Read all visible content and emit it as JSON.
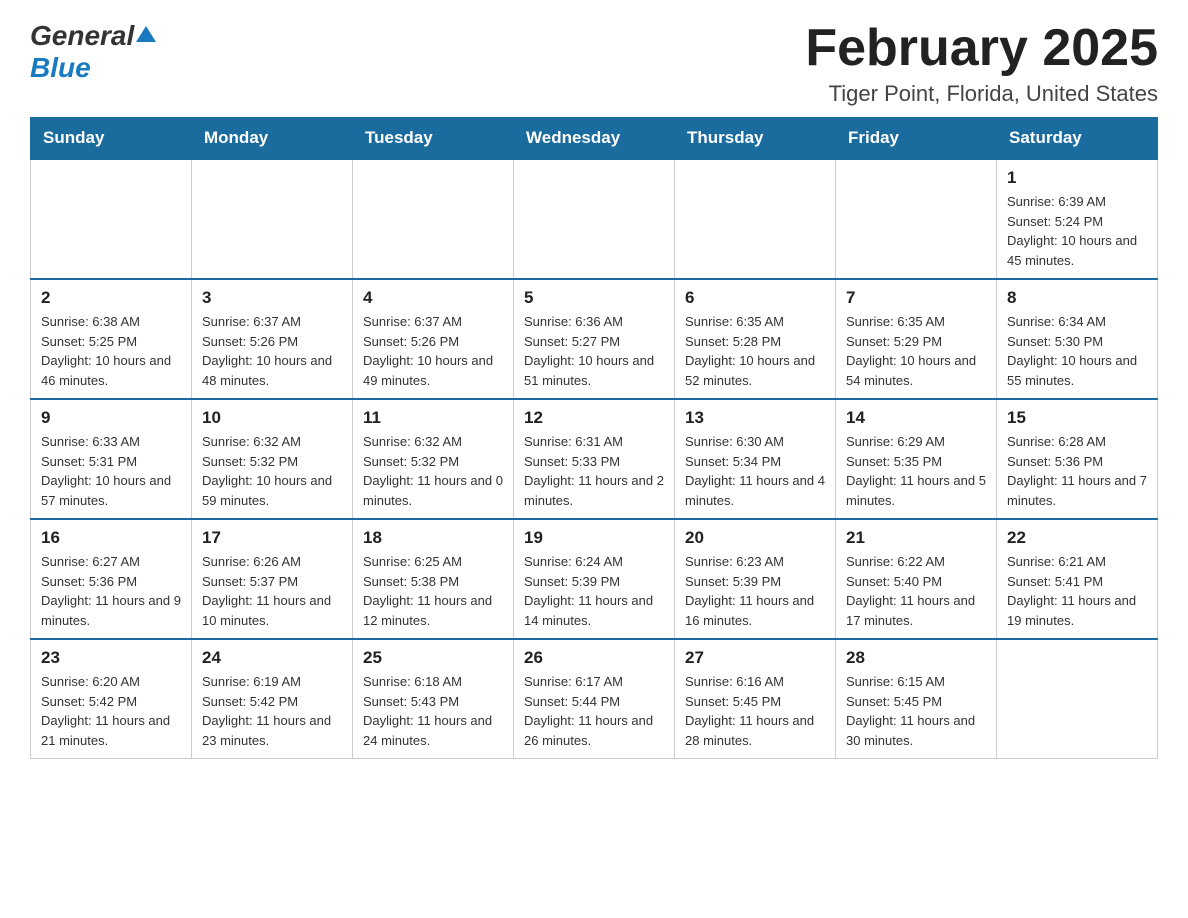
{
  "header": {
    "logo_general": "General",
    "logo_blue": "Blue",
    "month_title": "February 2025",
    "location": "Tiger Point, Florida, United States"
  },
  "days_of_week": [
    "Sunday",
    "Monday",
    "Tuesday",
    "Wednesday",
    "Thursday",
    "Friday",
    "Saturday"
  ],
  "weeks": [
    [
      {
        "day": "",
        "info": ""
      },
      {
        "day": "",
        "info": ""
      },
      {
        "day": "",
        "info": ""
      },
      {
        "day": "",
        "info": ""
      },
      {
        "day": "",
        "info": ""
      },
      {
        "day": "",
        "info": ""
      },
      {
        "day": "1",
        "info": "Sunrise: 6:39 AM\nSunset: 5:24 PM\nDaylight: 10 hours and 45 minutes."
      }
    ],
    [
      {
        "day": "2",
        "info": "Sunrise: 6:38 AM\nSunset: 5:25 PM\nDaylight: 10 hours and 46 minutes."
      },
      {
        "day": "3",
        "info": "Sunrise: 6:37 AM\nSunset: 5:26 PM\nDaylight: 10 hours and 48 minutes."
      },
      {
        "day": "4",
        "info": "Sunrise: 6:37 AM\nSunset: 5:26 PM\nDaylight: 10 hours and 49 minutes."
      },
      {
        "day": "5",
        "info": "Sunrise: 6:36 AM\nSunset: 5:27 PM\nDaylight: 10 hours and 51 minutes."
      },
      {
        "day": "6",
        "info": "Sunrise: 6:35 AM\nSunset: 5:28 PM\nDaylight: 10 hours and 52 minutes."
      },
      {
        "day": "7",
        "info": "Sunrise: 6:35 AM\nSunset: 5:29 PM\nDaylight: 10 hours and 54 minutes."
      },
      {
        "day": "8",
        "info": "Sunrise: 6:34 AM\nSunset: 5:30 PM\nDaylight: 10 hours and 55 minutes."
      }
    ],
    [
      {
        "day": "9",
        "info": "Sunrise: 6:33 AM\nSunset: 5:31 PM\nDaylight: 10 hours and 57 minutes."
      },
      {
        "day": "10",
        "info": "Sunrise: 6:32 AM\nSunset: 5:32 PM\nDaylight: 10 hours and 59 minutes."
      },
      {
        "day": "11",
        "info": "Sunrise: 6:32 AM\nSunset: 5:32 PM\nDaylight: 11 hours and 0 minutes."
      },
      {
        "day": "12",
        "info": "Sunrise: 6:31 AM\nSunset: 5:33 PM\nDaylight: 11 hours and 2 minutes."
      },
      {
        "day": "13",
        "info": "Sunrise: 6:30 AM\nSunset: 5:34 PM\nDaylight: 11 hours and 4 minutes."
      },
      {
        "day": "14",
        "info": "Sunrise: 6:29 AM\nSunset: 5:35 PM\nDaylight: 11 hours and 5 minutes."
      },
      {
        "day": "15",
        "info": "Sunrise: 6:28 AM\nSunset: 5:36 PM\nDaylight: 11 hours and 7 minutes."
      }
    ],
    [
      {
        "day": "16",
        "info": "Sunrise: 6:27 AM\nSunset: 5:36 PM\nDaylight: 11 hours and 9 minutes."
      },
      {
        "day": "17",
        "info": "Sunrise: 6:26 AM\nSunset: 5:37 PM\nDaylight: 11 hours and 10 minutes."
      },
      {
        "day": "18",
        "info": "Sunrise: 6:25 AM\nSunset: 5:38 PM\nDaylight: 11 hours and 12 minutes."
      },
      {
        "day": "19",
        "info": "Sunrise: 6:24 AM\nSunset: 5:39 PM\nDaylight: 11 hours and 14 minutes."
      },
      {
        "day": "20",
        "info": "Sunrise: 6:23 AM\nSunset: 5:39 PM\nDaylight: 11 hours and 16 minutes."
      },
      {
        "day": "21",
        "info": "Sunrise: 6:22 AM\nSunset: 5:40 PM\nDaylight: 11 hours and 17 minutes."
      },
      {
        "day": "22",
        "info": "Sunrise: 6:21 AM\nSunset: 5:41 PM\nDaylight: 11 hours and 19 minutes."
      }
    ],
    [
      {
        "day": "23",
        "info": "Sunrise: 6:20 AM\nSunset: 5:42 PM\nDaylight: 11 hours and 21 minutes."
      },
      {
        "day": "24",
        "info": "Sunrise: 6:19 AM\nSunset: 5:42 PM\nDaylight: 11 hours and 23 minutes."
      },
      {
        "day": "25",
        "info": "Sunrise: 6:18 AM\nSunset: 5:43 PM\nDaylight: 11 hours and 24 minutes."
      },
      {
        "day": "26",
        "info": "Sunrise: 6:17 AM\nSunset: 5:44 PM\nDaylight: 11 hours and 26 minutes."
      },
      {
        "day": "27",
        "info": "Sunrise: 6:16 AM\nSunset: 5:45 PM\nDaylight: 11 hours and 28 minutes."
      },
      {
        "day": "28",
        "info": "Sunrise: 6:15 AM\nSunset: 5:45 PM\nDaylight: 11 hours and 30 minutes."
      },
      {
        "day": "",
        "info": ""
      }
    ]
  ]
}
